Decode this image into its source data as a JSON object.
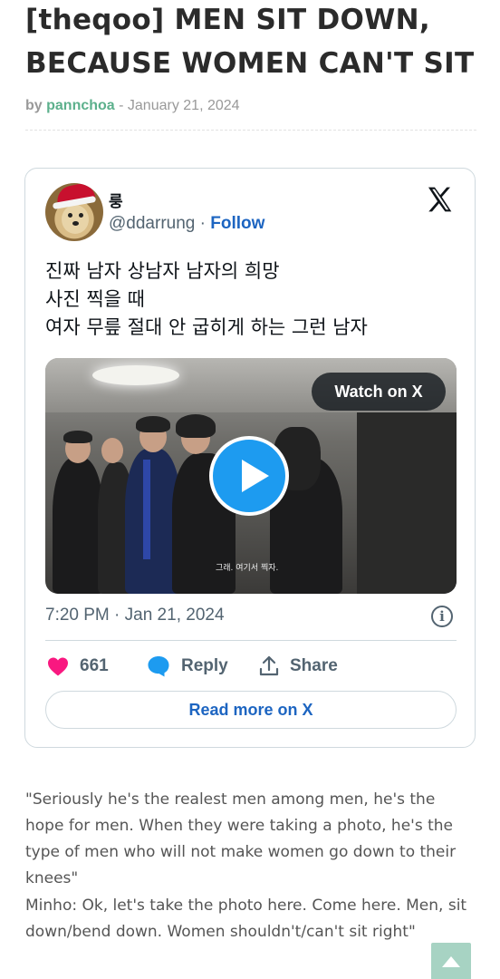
{
  "article": {
    "title": "[theqoo] MEN SIT DOWN, BECAUSE WOMEN CAN'T SIT",
    "by_label": "by",
    "author": "pannchoa",
    "separator": " - ",
    "date": "January 21, 2024"
  },
  "tweet": {
    "display_name": "룽",
    "handle": "@ddarrung",
    "dot": " · ",
    "follow_label": "Follow",
    "text": "진짜 남자 상남자 남자의 희망\n사진 찍을 때\n여자 무릎 절대 안 굽히게 하는 그런 남자",
    "watch_label": "Watch on X",
    "video_subtitle": "그래. 여기서 찍자.",
    "timestamp": "7:20 PM · Jan 21, 2024",
    "likes": "661",
    "reply_label": "Reply",
    "share_label": "Share",
    "read_more_label": "Read more on X",
    "icons": [
      "x-logo-icon",
      "info-icon",
      "heart-icon",
      "reply-bubble-icon",
      "share-icon",
      "play-icon"
    ],
    "colors": {
      "like": "#f91880",
      "link": "#1d65c1",
      "play": "#1d9bf0"
    }
  },
  "body": {
    "translation": "\"Seriously he's the realest men among men, he's the hope for men. When they were taking a photo, he's the type of men who will not make women go down to their knees\"",
    "quote": "Minho: Ok, let's take the photo here. Come here. Men, sit down/bend down. Women shouldn't/can't sit right\""
  },
  "accent_color": "#5cb08c"
}
